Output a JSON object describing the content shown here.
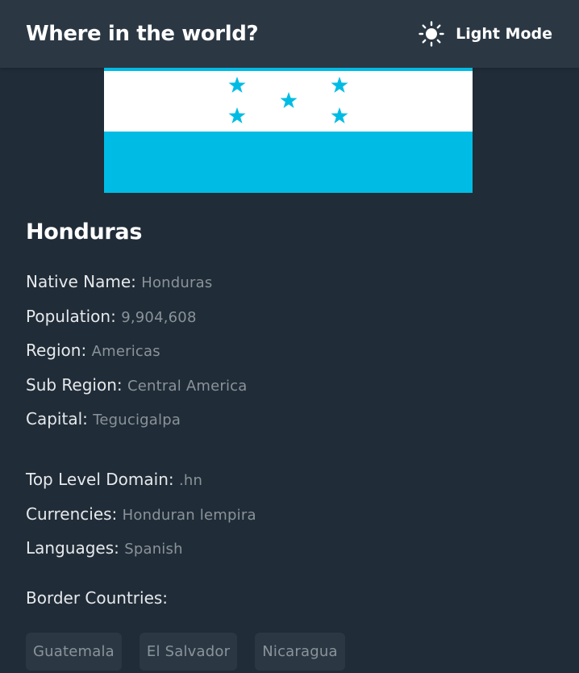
{
  "header": {
    "title": "Where in the world?",
    "theme_toggle_label": "Light Mode",
    "theme_toggle_icon": "sun-icon"
  },
  "country": {
    "flag": {
      "description_icon": "honduras-flag",
      "colors": {
        "stripe": "#00bce4",
        "field": "#ffffff"
      }
    },
    "name": "Honduras",
    "fields": [
      {
        "label": "Native Name:",
        "value": "Honduras"
      },
      {
        "label": "Population:",
        "value": "9,904,608"
      },
      {
        "label": "Region:",
        "value": "Americas"
      },
      {
        "label": "Sub Region:",
        "value": "Central America"
      },
      {
        "label": "Capital:",
        "value": "Tegucigalpa"
      },
      {
        "label": "Top Level Domain:",
        "value": ".hn"
      },
      {
        "label": "Currencies:",
        "value": "Honduran lempira"
      },
      {
        "label": "Languages:",
        "value": "Spanish"
      }
    ],
    "border_title": "Border Countries:",
    "borders": [
      "Guatemala",
      "El Salvador",
      "Nicaragua"
    ]
  },
  "colors": {
    "background": "#202c37",
    "elements": "#2b3844",
    "text": "#ffffff",
    "muted_text": "#8a939b"
  }
}
